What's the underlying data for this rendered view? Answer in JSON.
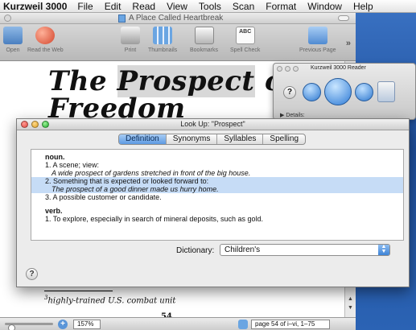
{
  "menubar": {
    "app": "Kurzweil 3000",
    "items": [
      "File",
      "Edit",
      "Read",
      "View",
      "Tools",
      "Scan",
      "Format",
      "Window",
      "Help"
    ]
  },
  "document": {
    "title": "A Place Called Heartbreak",
    "toolbar": {
      "open": "Open",
      "read_web": "Read the Web",
      "print": "Print",
      "thumbnails": "Thumbnails",
      "bookmarks": "Bookmarks",
      "spell_check": "Spell Check",
      "spell_badge": "ABC",
      "previous_page": "Previous Page"
    },
    "headline_line1_start": "The ",
    "headline_highlight": "Prospect",
    "headline_line1_end": " of",
    "headline_line2": "Freedom",
    "footnote_number": "3",
    "footnote_text": "highly-trained U.S. combat unit",
    "bottom_glyph": "54",
    "zoom": "157%",
    "page_indicator": "page 54 of i–vi, 1–75"
  },
  "reader": {
    "title": "Kurzweil 3000 Reader",
    "details_label": "Details:"
  },
  "dialog": {
    "title": "Look Up: \"Prospect\"",
    "tabs": [
      "Definition",
      "Synonyms",
      "Syllables",
      "Spelling"
    ],
    "active_tab": "Definition",
    "definition": {
      "noun_label": "noun.",
      "noun_1": "1. A scene; view:",
      "noun_1_example": "A wide prospect of gardens stretched in front of the big house.",
      "noun_2": "2. Something that is expected or looked forward to:",
      "noun_2_example": "The prospect of a good dinner made us hurry home.",
      "noun_3": "3. A possible customer or candidate.",
      "verb_label": "verb.",
      "verb_1": "1. To explore, especially in search of mineral deposits, such as gold."
    },
    "dictionary_label": "Dictionary:",
    "dictionary_value": "Children's",
    "help": "?"
  },
  "colors": {
    "accent_blue": "#5d9ae2",
    "selection": "#c6dcf6",
    "close_red": "#e0443e",
    "minimize_yellow": "#dea123",
    "zoom_green": "#1aab29"
  }
}
